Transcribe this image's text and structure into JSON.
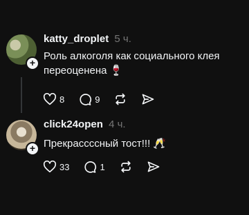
{
  "comments": [
    {
      "username": "katty_droplet",
      "time": "5 ч.",
      "text": "Роль алкоголя как социального клея переоценена 🍷",
      "likes": "8",
      "replies": "9"
    },
    {
      "username": "click24open",
      "time": "4 ч.",
      "text": "Прекрассссный тост!!! 🥂",
      "likes": "33",
      "replies": "1"
    }
  ],
  "icons": {
    "like": "heart-icon",
    "reply": "comment-icon",
    "repost": "repost-icon",
    "share": "send-icon",
    "follow": "plus-icon"
  },
  "colors": {
    "background": "#101010",
    "text": "#f3f5f7",
    "muted": "#777777"
  }
}
